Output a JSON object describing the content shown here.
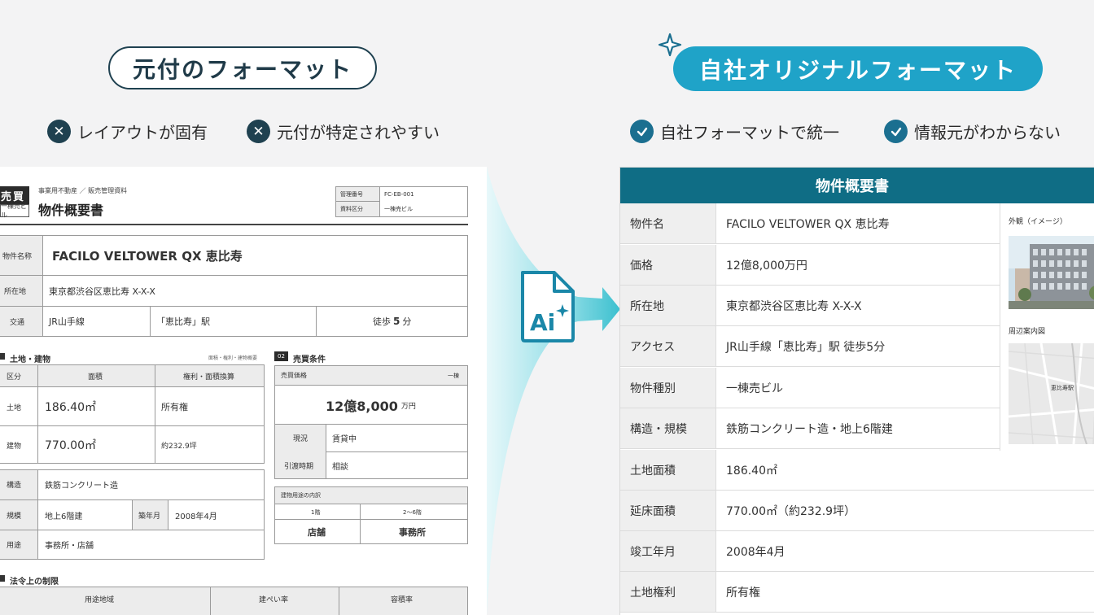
{
  "header": {
    "left_title": "元付のフォーマット",
    "right_title": "自社オリジナルフォーマット",
    "left_points": [
      "レイアウトが固有",
      "元付が特定されやすい"
    ],
    "right_points": [
      "自社フォーマットで統一",
      "情報元がわからない"
    ]
  },
  "ai_label": "Ai",
  "colors": {
    "dark_navy": "#1f4150",
    "accent": "#1fa3c8",
    "table_header": "#0f6d85"
  },
  "original_sheet": {
    "tag": "売買",
    "tag_sub": "一棟売ビル",
    "subtitle": "事業用不動産 ／ 販売管理資料",
    "title": "物件概要書",
    "mgmt": [
      {
        "label": "管理番号",
        "value": "FC-EB-001"
      },
      {
        "label": "資料区分",
        "value": "一棟売ビル"
      }
    ],
    "property_name_label": "物件名称",
    "property_name": "FACILO VELTOWER QX 恵比寿",
    "address_label": "所在地",
    "address": "東京都渋谷区恵比寿 X-X-X",
    "transport_label": "交通",
    "line": "JR山手線",
    "station": "「恵比寿」駅",
    "walk_prefix": "徒歩",
    "walk_num": "5",
    "walk_unit": "分",
    "land_section": {
      "title": "土地・建物",
      "note": "面積・権利・建物概要",
      "headers": [
        "区分",
        "面積",
        "権利・面積換算"
      ],
      "rows": [
        {
          "kind": "土地",
          "area": "186.40㎡",
          "right": "所有権"
        },
        {
          "kind": "建物",
          "area": "770.00㎡",
          "right": "約232.9坪"
        }
      ]
    },
    "building": {
      "structure_label": "構造",
      "structure": "鉄筋コンクリート造",
      "scale_label": "規模",
      "scale": "地上6階建",
      "built_label": "築年月",
      "built": "2008年4月",
      "use_label": "用途",
      "use": "事務所・店舗"
    },
    "sale_section": {
      "num": "02",
      "title": "売買条件",
      "price_label": "売買価格",
      "price_note": "一棟",
      "price": "12億8,000",
      "price_unit": "万円",
      "status_label": "現況",
      "status": "賃貸中",
      "handover_label": "引渡時期",
      "handover": "相談",
      "usage_title": "建物用途の内訳",
      "usage": [
        {
          "floor": "1階",
          "use": "店舗"
        },
        {
          "floor": "2〜6階",
          "use": "事務所"
        }
      ]
    },
    "law_section": {
      "title": "法令上の制限",
      "headers": [
        "用途地域",
        "建ぺい率",
        "容積率"
      ]
    }
  },
  "own_format": {
    "title": "物件概要書",
    "rows": [
      {
        "label": "物件名",
        "value": "FACILO VELTOWER QX 恵比寿"
      },
      {
        "label": "価格",
        "value": "12億8,000万円"
      },
      {
        "label": "所在地",
        "value": "東京都渋谷区恵比寿 X-X-X"
      },
      {
        "label": "アクセス",
        "value": "JR山手線「恵比寿」駅 徒歩5分"
      },
      {
        "label": "物件種別",
        "value": "一棟売ビル"
      },
      {
        "label": "構造・規模",
        "value": "鉄筋コンクリート造・地上6階建"
      },
      {
        "label": "土地面積",
        "value": "186.40㎡"
      },
      {
        "label": "延床面積",
        "value": "770.00㎡（約232.9坪）"
      },
      {
        "label": "竣工年月",
        "value": "2008年4月"
      },
      {
        "label": "土地権利",
        "value": "所有権"
      }
    ],
    "exterior_label": "外観（イメージ）",
    "map_label": "周辺案内図",
    "map_station": "恵比寿駅"
  }
}
